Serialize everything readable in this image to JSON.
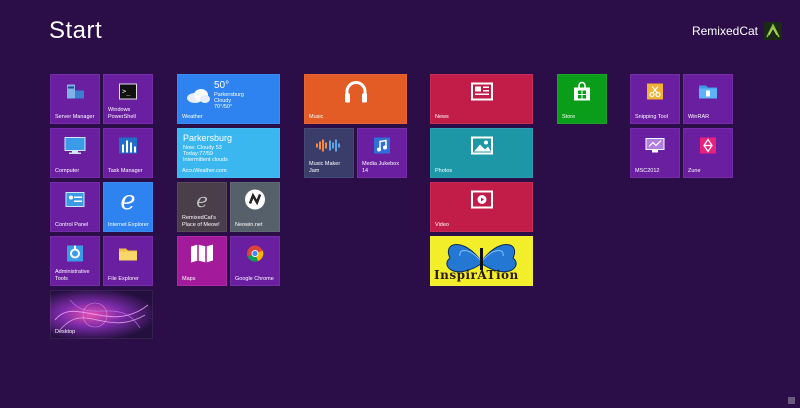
{
  "header": {
    "title": "Start"
  },
  "user": {
    "name": "RemixedCat"
  },
  "colors": {
    "background": "#2b0d48",
    "tile_purple": "#6a1ea0",
    "tile_blue": "#2e83f0",
    "tile_sky": "#3ab7ef",
    "tile_orange": "#e35b25",
    "tile_red": "#c21c49",
    "tile_teal": "#1d96a6",
    "tile_green": "#0a9d1a"
  },
  "tiles": {
    "server_manager": "Server Manager",
    "powershell": "Windows PowerShell",
    "computer": "Computer",
    "task_manager": "Task Manager",
    "control_panel": "Control Panel",
    "internet_explorer": "Internet Explorer",
    "admin_tools": "Administrative Tools",
    "file_explorer": "File Explorer",
    "desktop": "Desktop",
    "weather": {
      "label": "Weather",
      "temp": "50°",
      "city": "Parkersburg",
      "cond": "Cloudy",
      "range": "70°/50°"
    },
    "accuweather": {
      "label": "AccuWeather.com",
      "city": "Parkersburg",
      "line1": "Now: Cloudy 53",
      "line2": "Today:77/59",
      "line3": "Intermittent clouds"
    },
    "remixedcat": "RemixedCat's Place of Meow!",
    "neowin": "Neowin.net",
    "maps": "Maps",
    "chrome": "Google Chrome",
    "music": "Music",
    "music_maker": "Music Maker Jam",
    "media_jukebox": "Media Jukebox 14",
    "news": "News",
    "photos": "Photos",
    "video": "Video",
    "inspiration_text": "InspirATion",
    "store": "Store",
    "snipping": "Snipping Tool",
    "winrar": "WinRAR",
    "msc2012": "MSC2012",
    "zune": "Zune"
  }
}
